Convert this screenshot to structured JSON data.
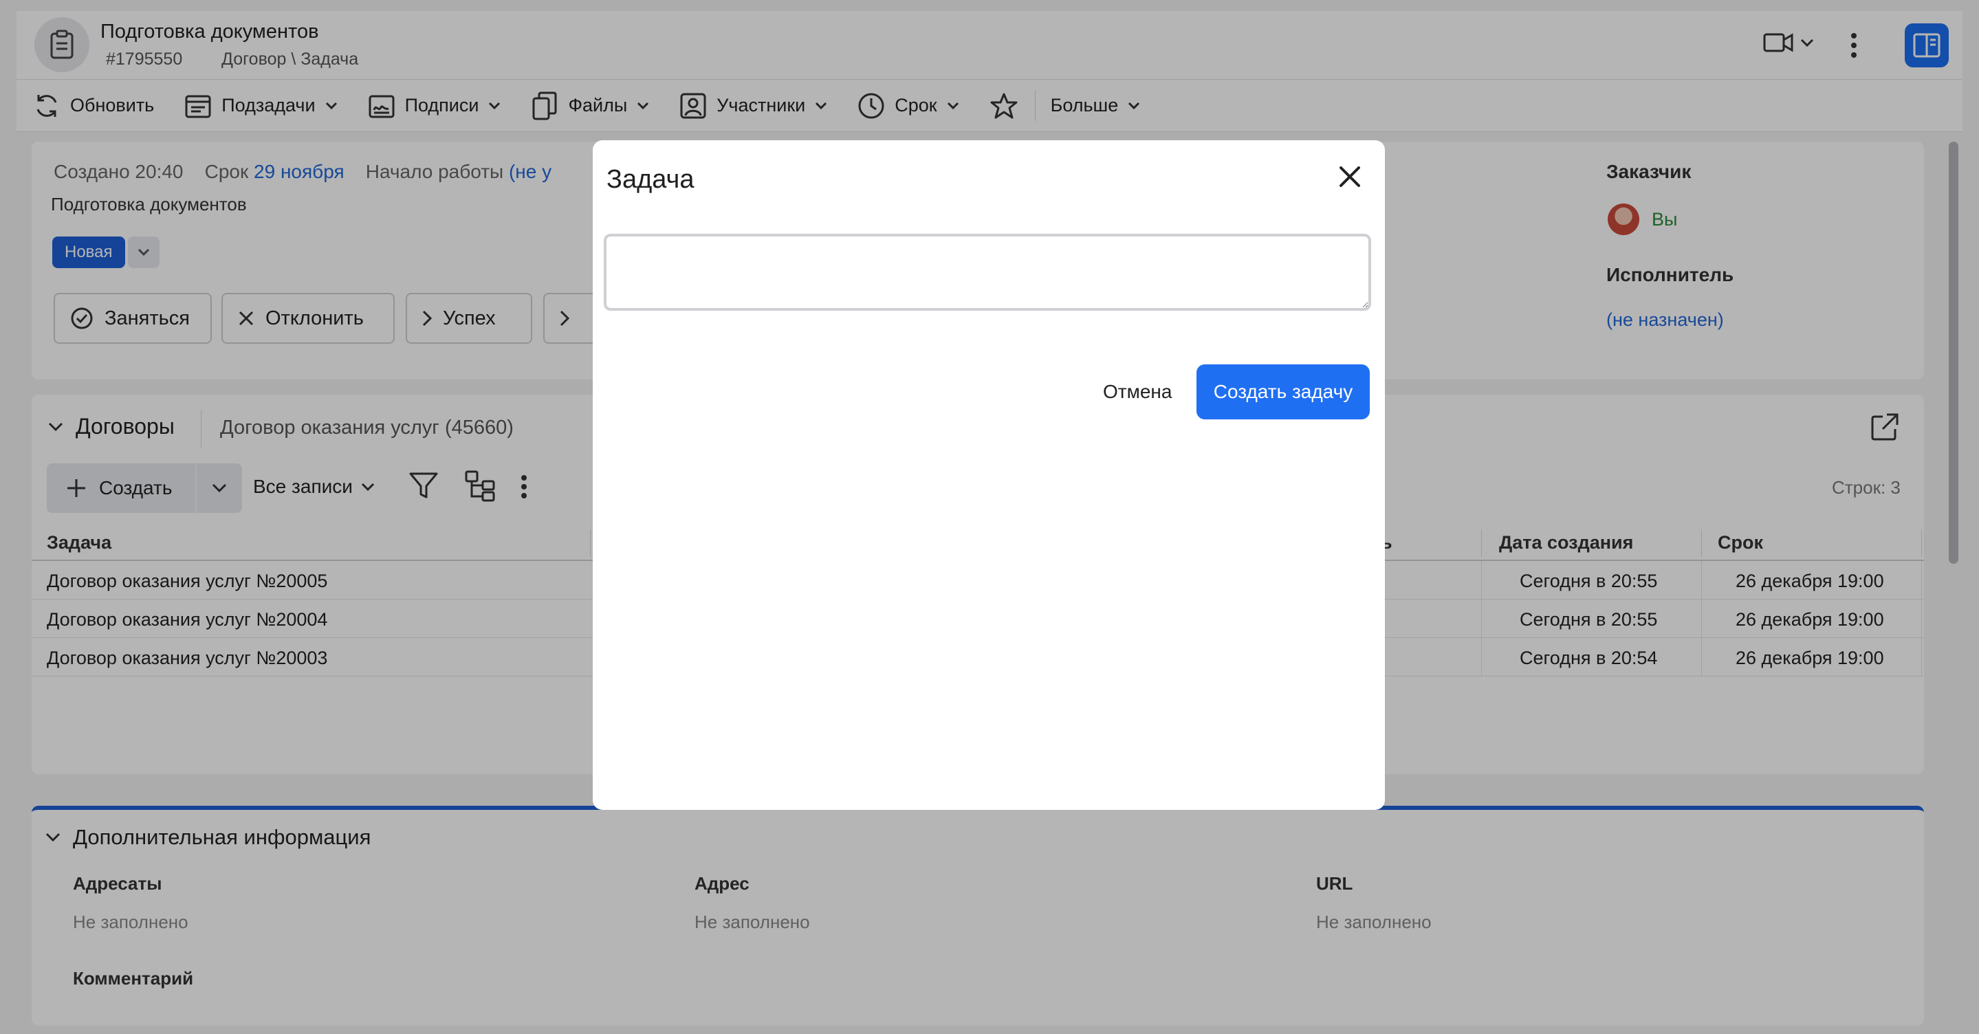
{
  "header": {
    "title": "Подготовка документов",
    "id": "#1795550",
    "path": "Договор \\ Задача"
  },
  "toolbar": {
    "refresh": "Обновить",
    "subtasks": "Подзадачи",
    "signatures": "Подписи",
    "files": "Файлы",
    "participants": "Участники",
    "deadline": "Срок",
    "more": "Больше"
  },
  "task": {
    "created_label": "Создано 20:40",
    "due_prefix": "Срок",
    "due_date": "29 ноября",
    "start_prefix": "Начало работы",
    "start_value": "(не у",
    "subtitle": "Подготовка документов",
    "status": "Новая",
    "actions": {
      "take": "Заняться",
      "reject": "Отклонить",
      "success": "Успех"
    },
    "customer_label": "Заказчик",
    "customer_value": "Вы",
    "executor_label": "Исполнитель",
    "executor_value": "(не назначен)"
  },
  "contracts": {
    "title": "Договоры",
    "subtitle": "Договор оказания услуг (45660)",
    "create_label": "Создать",
    "all_records": "Все записи",
    "rows_count": "Строк: 3",
    "columns": {
      "task": "Задача",
      "partial": "ь",
      "created": "Дата создания",
      "due": "Срок"
    },
    "rows": [
      {
        "task": "Договор оказания услуг №20005",
        "created": "Сегодня в 20:55",
        "due": "26 декабря 19:00"
      },
      {
        "task": "Договор оказания услуг №20004",
        "created": "Сегодня в 20:55",
        "due": "26 декабря 19:00"
      },
      {
        "task": "Договор оказания услуг №20003",
        "created": "Сегодня в 20:54",
        "due": "26 декабря 19:00"
      }
    ]
  },
  "extra": {
    "title": "Дополнительная информация",
    "addressees_label": "Адресаты",
    "addressees_value": "Не заполнено",
    "address_label": "Адрес",
    "address_value": "Не заполнено",
    "url_label": "URL",
    "url_value": "Не заполнено",
    "comment_label": "Комментарий"
  },
  "modal": {
    "title": "Задача",
    "textarea_value": "",
    "cancel_label": "Отмена",
    "create_label": "Создать задачу"
  },
  "colors": {
    "accent": "#1f6ff2",
    "link": "#2367d8",
    "status_badge": "#1d5fd6",
    "customer_green": "#2a8a3a"
  }
}
